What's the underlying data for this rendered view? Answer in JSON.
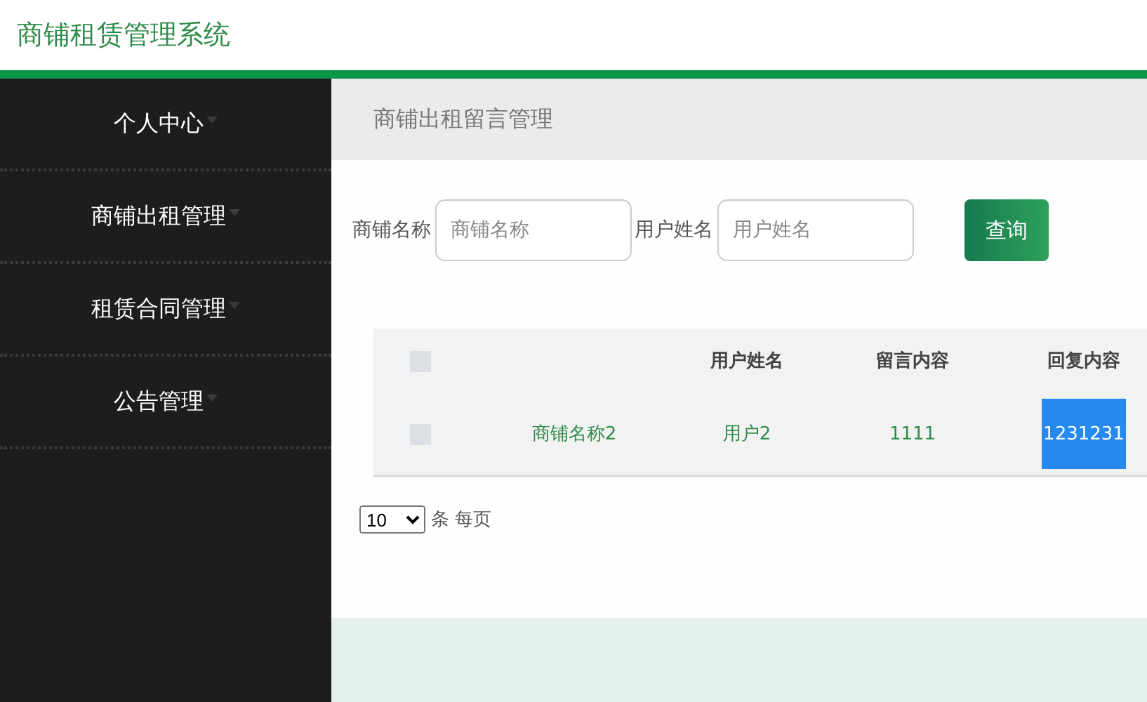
{
  "app_title": "商铺租赁管理系统",
  "sidebar": {
    "items": [
      {
        "label": "个人中心",
        "expanded": false
      },
      {
        "label": "商铺出租管理",
        "expanded": false
      },
      {
        "label": "租赁合同管理",
        "expanded": false
      },
      {
        "label": "公告管理",
        "expanded": false
      }
    ]
  },
  "breadcrumb": "商铺出租留言管理",
  "search": {
    "fields": [
      {
        "label": "商铺名称",
        "placeholder": "商铺名称"
      },
      {
        "label": "用户姓名",
        "placeholder": "用户姓名"
      }
    ],
    "button": "查询"
  },
  "table": {
    "header_checked": false,
    "columns": [
      "",
      "用户姓名",
      "留言内容",
      "回复内容"
    ],
    "rows": [
      {
        "checked": false,
        "cells": [
          "商铺名称2",
          "用户2",
          "1111",
          "1231231"
        ]
      }
    ]
  },
  "pagination": {
    "page_size": "10",
    "label": "条 每页"
  }
}
